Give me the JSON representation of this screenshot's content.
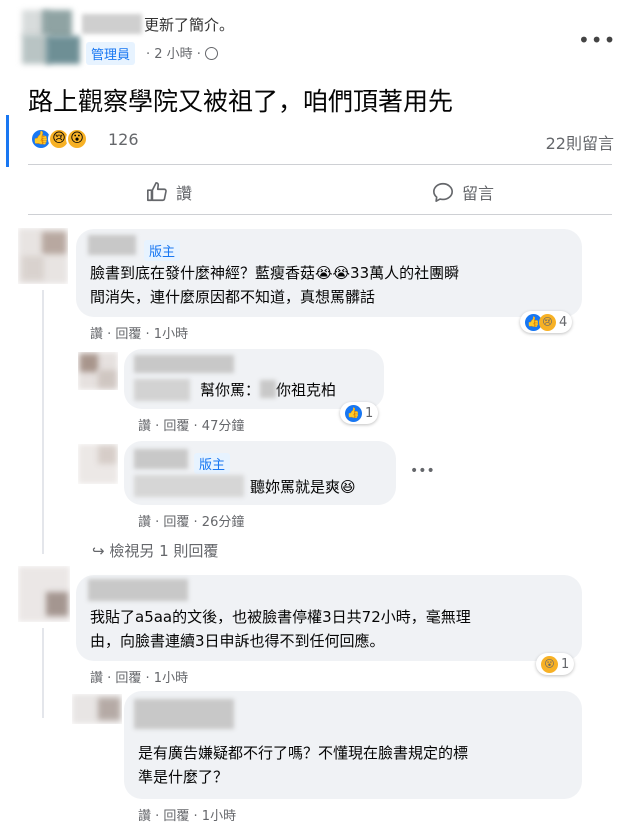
{
  "header": {
    "updated_text": "更新了簡介。",
    "role_badge": "管理員",
    "time_meta": "· 2 小時 ·",
    "globe_icon": "globe-icon",
    "more_icon": "•••"
  },
  "post": {
    "text": "路上觀察學院又被祖了，咱們頂著用先",
    "reaction_count": "126",
    "comment_count": "22則留言"
  },
  "actions": {
    "like_label": "讚",
    "comment_label": "留言"
  },
  "comments": [
    {
      "badge": "版主",
      "line1": "臉書到底在發什麼神經？藍瘦香菇😭😭33萬人的社團瞬",
      "line2": "間消失，連什麼原因都不知道，真想罵髒話",
      "meta": "讚 · 回覆 · 1小時",
      "reaction_count": "4"
    },
    {
      "text_prefix": "幫你罵：",
      "text_suffix": "你祖克柏",
      "meta": "讚 · 回覆 · 47分鐘",
      "reaction_count": "1"
    },
    {
      "badge": "版主",
      "text": "聽妳罵就是爽😆",
      "meta": "讚 · 回覆 · 26分鐘",
      "more": "•••"
    },
    {
      "view_more": "↪ 檢視另 1 則回覆"
    },
    {
      "line1": "我貼了a5aa的文後，也被臉書停權3日共72小時，毫無理",
      "line2": "由，向臉書連續3日申訴也得不到任何回應。",
      "meta": "讚 · 回覆 · 1小時",
      "reaction_count": "1"
    },
    {
      "line1": "是有廣告嫌疑都不行了嗎？不懂現在臉書規定的標",
      "line2": "準是什麼了？",
      "meta": "讚 · 回覆 · 1小時"
    }
  ],
  "colors": {
    "accent": "#1877f2",
    "bubble": "#f0f2f5",
    "meta": "#65676b"
  }
}
